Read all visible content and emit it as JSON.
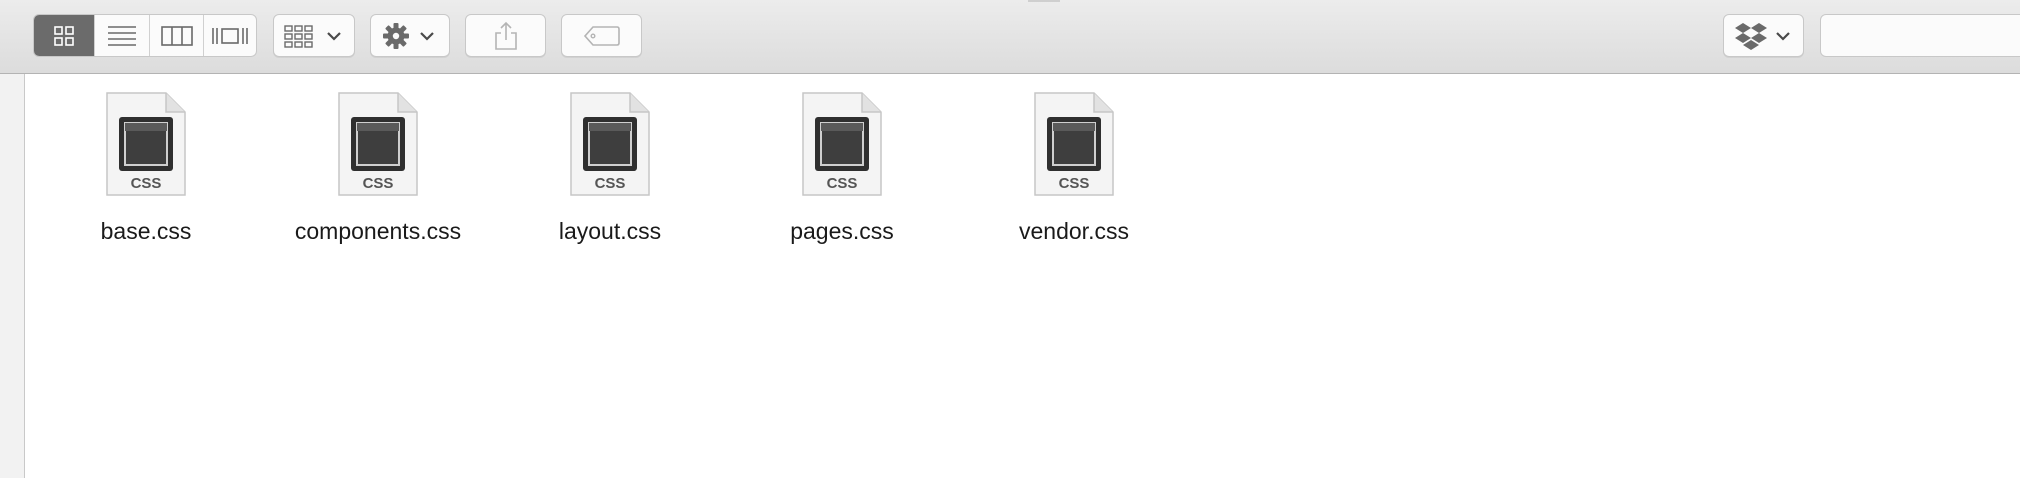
{
  "toolbar": {
    "view_modes": [
      {
        "name": "icon-view",
        "icon": "grid-icon",
        "active": true
      },
      {
        "name": "list-view",
        "icon": "list-icon",
        "active": false
      },
      {
        "name": "column-view",
        "icon": "columns-icon",
        "active": false
      },
      {
        "name": "cover-flow-view",
        "icon": "cover-flow-icon",
        "active": false
      }
    ],
    "arrange_icon": "arrange-grid-icon",
    "action_icon": "gear-icon",
    "share_icon": "share-icon",
    "tag_icon": "tag-icon",
    "dropbox_icon": "dropbox-icon",
    "search": {
      "value": "",
      "placeholder": ""
    }
  },
  "files": [
    {
      "name": "base.css",
      "badge": "CSS"
    },
    {
      "name": "components.css",
      "badge": "CSS"
    },
    {
      "name": "layout.css",
      "badge": "CSS"
    },
    {
      "name": "pages.css",
      "badge": "CSS"
    },
    {
      "name": "vendor.css",
      "badge": "CSS"
    }
  ],
  "colors": {
    "toolbar_top": "#ececec",
    "toolbar_bottom": "#dcdcdc",
    "active_segment": "#6b6b6b",
    "icon_gray": "#6a6a6a",
    "file_dark": "#2f2f2f"
  }
}
